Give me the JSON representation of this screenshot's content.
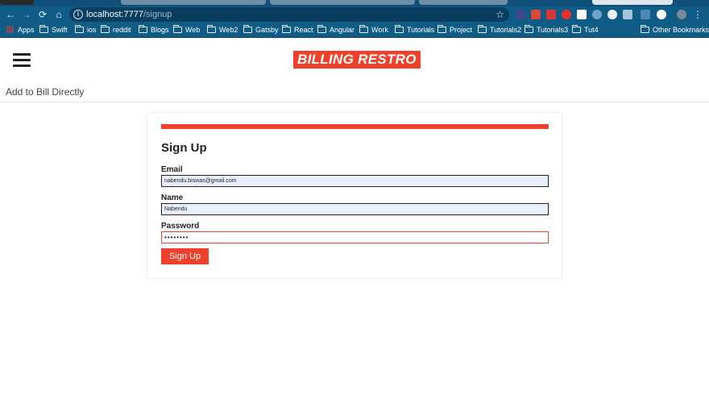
{
  "browser": {
    "url_host": "localhost:7777",
    "url_path": "/signup",
    "bookmarks": [
      "Apps",
      "Swift",
      "ios",
      "reddit",
      "Blogs",
      "Web",
      "Web2",
      "Gatsby",
      "React",
      "Angular",
      "Work",
      "Tutorials",
      "Project",
      "Tutorials2",
      "Tutorials3",
      "Tut4"
    ],
    "other_bookmarks": "Other Bookmarks"
  },
  "header": {
    "logo": "BILLING RESTRO",
    "nav_link": "Add to Bill Directly"
  },
  "form": {
    "title": "Sign Up",
    "email_label": "Email",
    "email_value": "nabendu.biswas@gmail.com",
    "name_label": "Name",
    "name_value": "Nabendu",
    "password_label": "Password",
    "password_mask": "••••••••",
    "submit_label": "Sign Up"
  },
  "colors": {
    "accent": "#f0402a",
    "browser_chrome": "#0f5c87"
  }
}
